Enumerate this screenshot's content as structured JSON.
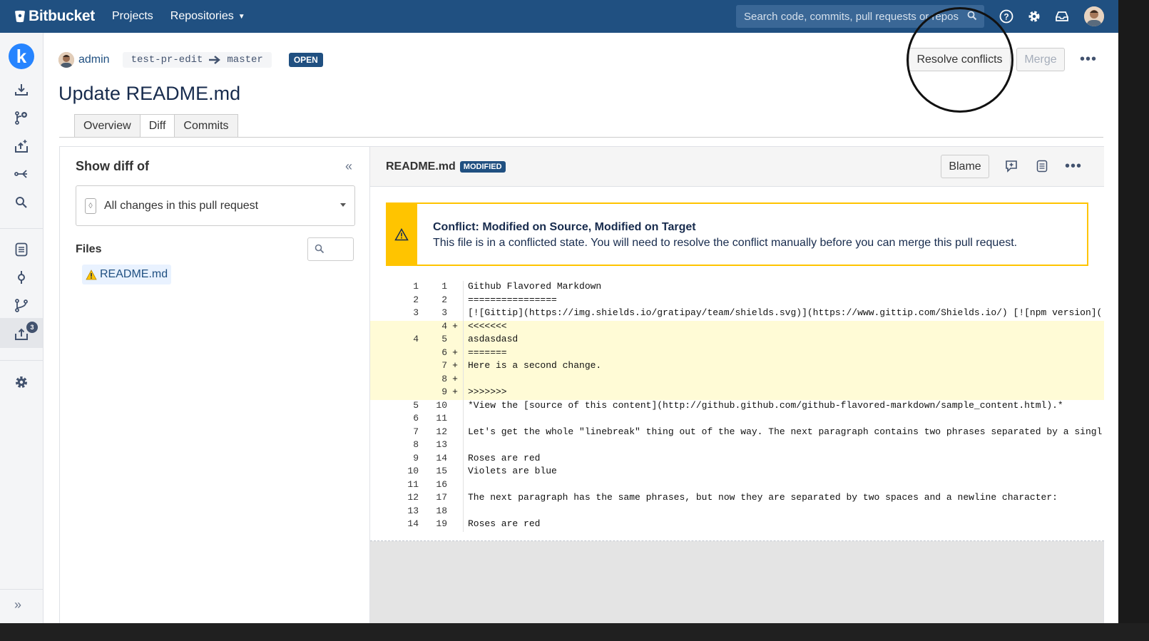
{
  "nav": {
    "brand": "Bitbucket",
    "projects": "Projects",
    "repositories": "Repositories",
    "search_placeholder": "Search code, commits, pull requests or repos",
    "icons": [
      "help-icon",
      "settings-icon",
      "inbox-icon",
      "user-avatar"
    ]
  },
  "sidebar": {
    "logo_letter": "k",
    "items": [
      "clone-icon",
      "create-branch-icon",
      "create-pull-request-icon",
      "fork-icon",
      "search-icon",
      "source-icon",
      "commits-icon",
      "branches-icon",
      "pull-requests-icon",
      "repo-settings-icon"
    ],
    "pull_requests_badge": "3",
    "expand": "»"
  },
  "pr": {
    "author": "admin",
    "source_branch": "test-pr-edit",
    "target_branch": "master",
    "state": "OPEN",
    "title": "Update README.md",
    "resolve_label": "Resolve conflicts",
    "merge_label": "Merge",
    "more": "•••"
  },
  "tabs": [
    {
      "label": "Overview",
      "active": false
    },
    {
      "label": "Diff",
      "active": true
    },
    {
      "label": "Commits",
      "active": false
    }
  ],
  "left_panel": {
    "title": "Show diff of",
    "collapse": "«",
    "select_value": "All changes in this pull request",
    "files_label": "Files",
    "files": [
      "README.md"
    ]
  },
  "diff": {
    "filename": "README.md",
    "status": "MODIFIED",
    "blame_label": "Blame",
    "more": "•••",
    "conflict_title": "Conflict: Modified on Source, Modified on Target",
    "conflict_desc": "This file is in a conflicted state. You will need to resolve the conflict manually before you can merge this pull request.",
    "lines": [
      {
        "old": "1",
        "new": "1",
        "mark": "",
        "code": "Github Flavored Markdown",
        "added": false
      },
      {
        "old": "2",
        "new": "2",
        "mark": "",
        "code": "================",
        "added": false
      },
      {
        "old": "3",
        "new": "3",
        "mark": "",
        "code": "[![Gittip](https://img.shields.io/gratipay/team/shields.svg)](https://www.gittip.com/Shields.io/) [![npm version](",
        "added": false
      },
      {
        "old": "",
        "new": "4",
        "mark": "+",
        "code": "<<<<<<<",
        "added": true
      },
      {
        "old": "4",
        "new": "5",
        "mark": "",
        "code": "asdasdasd",
        "added": true
      },
      {
        "old": "",
        "new": "6",
        "mark": "+",
        "code": "=======",
        "added": true
      },
      {
        "old": "",
        "new": "7",
        "mark": "+",
        "code": "Here is a second change.",
        "added": true
      },
      {
        "old": "",
        "new": "8",
        "mark": "+",
        "code": "",
        "added": true
      },
      {
        "old": "",
        "new": "9",
        "mark": "+",
        "code": ">>>>>>>",
        "added": true
      },
      {
        "old": "5",
        "new": "10",
        "mark": "",
        "code": "*View the [source of this content](http://github.github.com/github-flavored-markdown/sample_content.html).*",
        "added": false
      },
      {
        "old": "6",
        "new": "11",
        "mark": "",
        "code": "",
        "added": false
      },
      {
        "old": "7",
        "new": "12",
        "mark": "",
        "code": "Let's get the whole \"linebreak\" thing out of the way. The next paragraph contains two phrases separated by a singl",
        "added": false
      },
      {
        "old": "8",
        "new": "13",
        "mark": "",
        "code": "",
        "added": false
      },
      {
        "old": "9",
        "new": "14",
        "mark": "",
        "code": "Roses are red",
        "added": false
      },
      {
        "old": "10",
        "new": "15",
        "mark": "",
        "code": "Violets are blue",
        "added": false
      },
      {
        "old": "11",
        "new": "16",
        "mark": "",
        "code": "",
        "added": false
      },
      {
        "old": "12",
        "new": "17",
        "mark": "",
        "code": "The next paragraph has the same phrases, but now they are separated by two spaces and a newline character:",
        "added": false
      },
      {
        "old": "13",
        "new": "18",
        "mark": "",
        "code": "",
        "added": false
      },
      {
        "old": "14",
        "new": "19",
        "mark": "",
        "code": "Roses are red",
        "added": false
      }
    ]
  },
  "colors": {
    "brand": "#205081",
    "conflict": "#ffc400",
    "added_line": "#fffbd6"
  }
}
